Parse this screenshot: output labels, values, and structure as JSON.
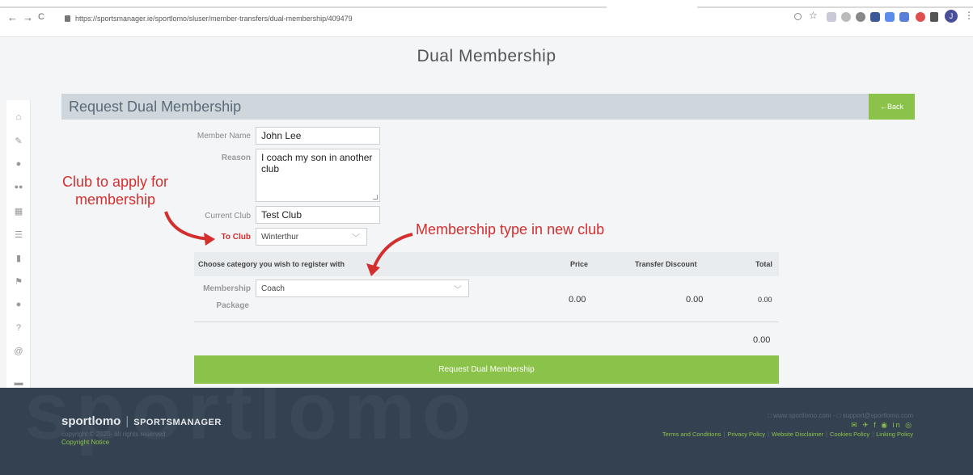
{
  "browser": {
    "url": "https://sportsmanager.ie/sportlomo/sluser/member-transfers/dual-membership/409479",
    "back_glyph": "←",
    "forward_glyph": "→",
    "reload_glyph": "C",
    "profile_initial": "J"
  },
  "page": {
    "title": "Dual Membership",
    "section_title": "Request Dual Membership",
    "back_button": "←Back"
  },
  "form": {
    "member_name_label": "Member Name",
    "member_name_value": "John  Lee",
    "reason_label": "Reason",
    "reason_line1": "I coach my son in another",
    "reason_line2": "club",
    "current_club_label": "Current Club",
    "current_club_value": "Test Club",
    "to_club_label": "To Club",
    "to_club_value": "Winterthur"
  },
  "table": {
    "col_category": "Choose category you wish to register with",
    "col_price": "Price",
    "col_discount": "Transfer Discount",
    "col_total": "Total",
    "membership_label": "Membership",
    "package_label": "Package",
    "membership_value": "Coach",
    "price": "0.00",
    "discount": "0.00",
    "total": "0.00",
    "grand_total": "0.00"
  },
  "submit_label": "Request Dual Membership",
  "annotations": {
    "club_line1": "Club to apply for",
    "club_line2": "membership",
    "type": "Membership type in new club"
  },
  "footer": {
    "watermark": "sportlomo",
    "brand": "sportlomo",
    "brand_sub": "SPORTSMANAGER",
    "copyright": "copyright © 2020- all rights reserved",
    "copyright_notice": "Copyright Notice",
    "contact": "□ www.sportlomo.com · □ support@sportlomo.com",
    "social": "✉ ✈ f ◉ in ◎",
    "links": [
      "Terms and Conditions",
      "Privacy Policy",
      "Website Disclaimer",
      "Cookies Policy",
      "Linking Policy"
    ]
  },
  "colors": {
    "accent_green": "#8bc34a",
    "annotation_red": "#d32f2f",
    "footer_bg": "#344150",
    "header_strip": "#cfd6dc"
  }
}
